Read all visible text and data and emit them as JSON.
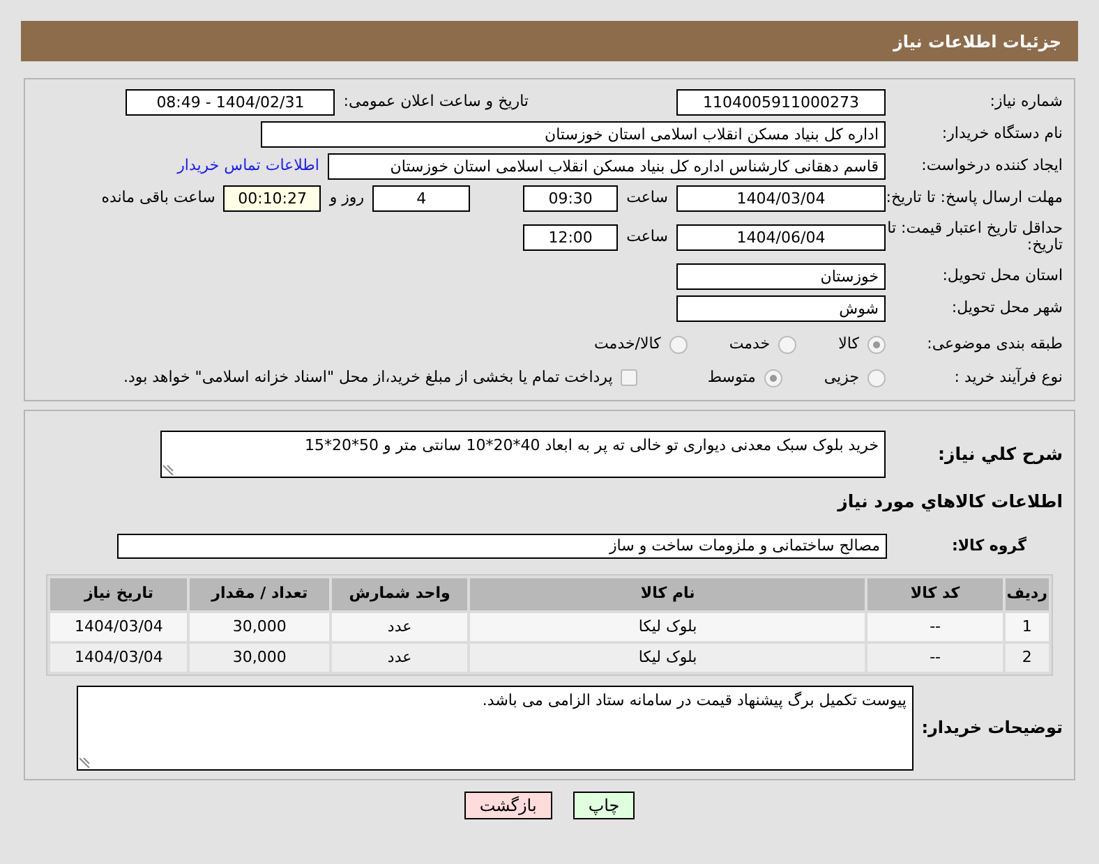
{
  "header": {
    "title": "جزئیات اطلاعات نیاز"
  },
  "need_number": {
    "label": "شماره نیاز:",
    "value": "1104005911000273"
  },
  "announce": {
    "label": "تاریخ و ساعت اعلان عمومی:",
    "value": "1404/02/31 - 08:49"
  },
  "buyer_org": {
    "label": "نام دستگاه خریدار:",
    "value": "اداره کل بنیاد مسکن انقلاب اسلامی استان خوزستان"
  },
  "requester": {
    "label": "ایجاد کننده درخواست:",
    "value": "قاسم دهقانی کارشناس اداره کل بنیاد مسکن انقلاب اسلامی استان خوزستان",
    "link": "اطلاعات تماس خریدار"
  },
  "deadline": {
    "label": "مهلت ارسال پاسخ: تا تاریخ:",
    "date": "1404/03/04",
    "time_label": "ساعت",
    "time": "09:30",
    "days": "4",
    "days_label": "روز و",
    "remaining": "00:10:27",
    "remaining_label": "ساعت باقی مانده"
  },
  "validity": {
    "label": "حداقل تاریخ اعتبار قیمت: تا تاریخ:",
    "date": "1404/06/04",
    "time_label": "ساعت",
    "time": "12:00"
  },
  "province": {
    "label": "استان محل تحویل:",
    "value": "خوزستان"
  },
  "city": {
    "label": "شهر محل تحویل:",
    "value": "شوش"
  },
  "category": {
    "label": "طبقه بندی موضوعی:",
    "options": [
      {
        "label": "کالا",
        "selected": true
      },
      {
        "label": "خدمت",
        "selected": false
      },
      {
        "label": "کالا/خدمت",
        "selected": false
      }
    ]
  },
  "process": {
    "label": "نوع فرآیند خرید :",
    "options": [
      {
        "label": "جزیی",
        "selected": false
      },
      {
        "label": "متوسط",
        "selected": true
      }
    ],
    "payment": {
      "label": "پرداخت تمام یا بخشی از مبلغ خرید،از محل \"اسناد خزانه اسلامی\" خواهد بود.",
      "checked": false
    }
  },
  "description": {
    "label": "شرح کلي نياز:",
    "value": "خرید بلوک  سبک معدنی دیواری تو خالی ته پر به ابعاد 40*20*10 سانتی متر  و 50*20*15"
  },
  "goods_title": "اطلاعات کالاهاي مورد نياز",
  "goods_group": {
    "label": "گروه کالا:",
    "value": "مصالح ساختمانی و ملزومات ساخت و ساز"
  },
  "table": {
    "columns": [
      "ردیف",
      "کد کالا",
      "نام کالا",
      "واحد شمارش",
      "تعداد / مقدار",
      "تاریخ نیاز"
    ],
    "rows": [
      [
        "1",
        "--",
        "بلوک لیکا",
        "عدد",
        "30,000",
        "1404/03/04"
      ],
      [
        "2",
        "--",
        "بلوک لیکا",
        "عدد",
        "30,000",
        "1404/03/04"
      ]
    ]
  },
  "buyer_notes": {
    "label": "توضیحات خریدار:",
    "value": "پیوست تکمیل برگ پیشنهاد قیمت در سامانه ستاد الزامی می باشد."
  },
  "buttons": [
    {
      "label": "چاپ",
      "kind": "print"
    },
    {
      "label": "بازگشت",
      "kind": "back"
    }
  ]
}
